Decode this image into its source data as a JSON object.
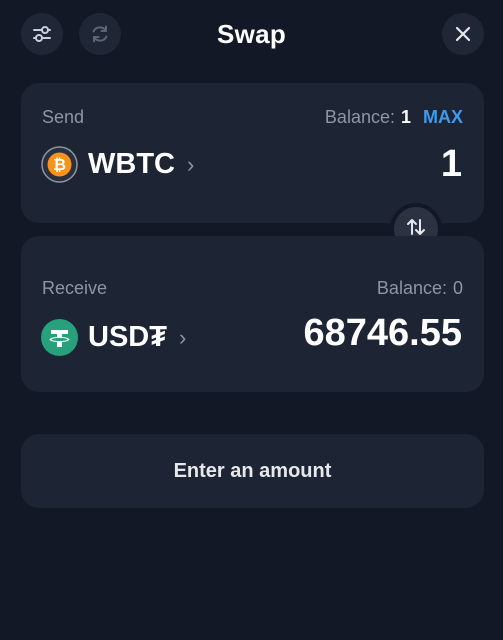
{
  "header": {
    "title": "Swap",
    "icons": [
      "sliders-icon",
      "refresh-icon",
      "close-icon"
    ]
  },
  "send": {
    "label": "Send",
    "balance_label": "Balance:",
    "balance_value": "1",
    "max_label": "MAX",
    "token_symbol": "WBTC",
    "token_icon": "bitcoin-icon",
    "amount": "1"
  },
  "receive": {
    "label": "Receive",
    "balance_label": "Balance:",
    "balance_value": "0",
    "token_symbol": "USD₮",
    "token_icon": "tether-icon",
    "amount": "68746.55"
  },
  "action_button": {
    "label": "Enter an amount"
  },
  "colors": {
    "background": "#121826",
    "card": "#1d2433",
    "accent": "#3b9cf0",
    "muted_text": "#8e95a3",
    "bitcoin_orange": "#f7931a",
    "tether_teal": "#26a17b"
  }
}
